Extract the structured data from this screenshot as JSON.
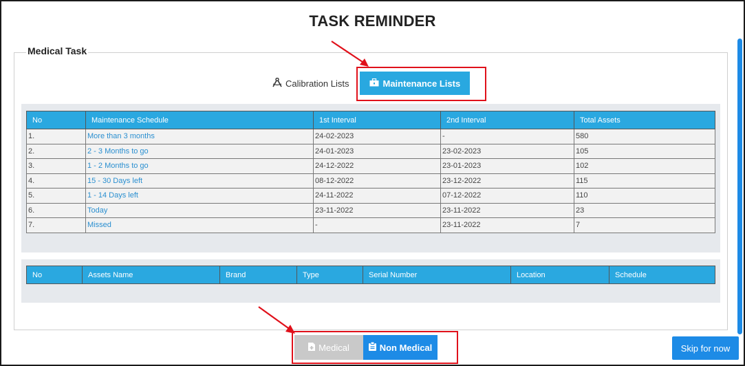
{
  "title": "TASK REMINDER",
  "section_legend": "Medical Task",
  "list_switch": {
    "calibration_label": "Calibration Lists",
    "maintenance_label": "Maintenance Lists"
  },
  "schedule_table": {
    "headers": [
      "No",
      "Maintenance Schedule",
      "1st Interval",
      "2nd Interval",
      "Total Assets"
    ],
    "rows": [
      [
        "1.",
        "More than 3 months",
        "24-02-2023",
        "-",
        "580"
      ],
      [
        "2.",
        "2 - 3 Months to go",
        "24-01-2023",
        "23-02-2023",
        "105"
      ],
      [
        "3.",
        "1 - 2 Months to go",
        "24-12-2022",
        "23-01-2023",
        "102"
      ],
      [
        "4.",
        "15 - 30 Days left",
        "08-12-2022",
        "23-12-2022",
        "115"
      ],
      [
        "5.",
        "1 - 14 Days left",
        "24-11-2022",
        "07-12-2022",
        "110"
      ],
      [
        "6.",
        "Today",
        "23-11-2022",
        "23-11-2022",
        "23"
      ],
      [
        "7.",
        "Missed",
        "-",
        "23-11-2022",
        "7"
      ]
    ]
  },
  "assets_table": {
    "headers": [
      "No",
      "Assets Name",
      "Brand",
      "Type",
      "Serial Number",
      "Location",
      "Schedule"
    ]
  },
  "bottom_tabs": {
    "medical_label": "Medical",
    "non_medical_label": "Non Medical"
  },
  "skip_label": "Skip for now",
  "colors": {
    "accent": "#29a8e0",
    "primary_button": "#1d8be6",
    "disabled_tab": "#c9c9c9",
    "highlight_box": "#e0101a",
    "link": "#2a8fd0"
  },
  "icons": {
    "calibration": "compass-drafting-icon",
    "maintenance": "toolbox-icon",
    "medical": "file-medical-icon",
    "non_medical": "clipboard-icon"
  }
}
